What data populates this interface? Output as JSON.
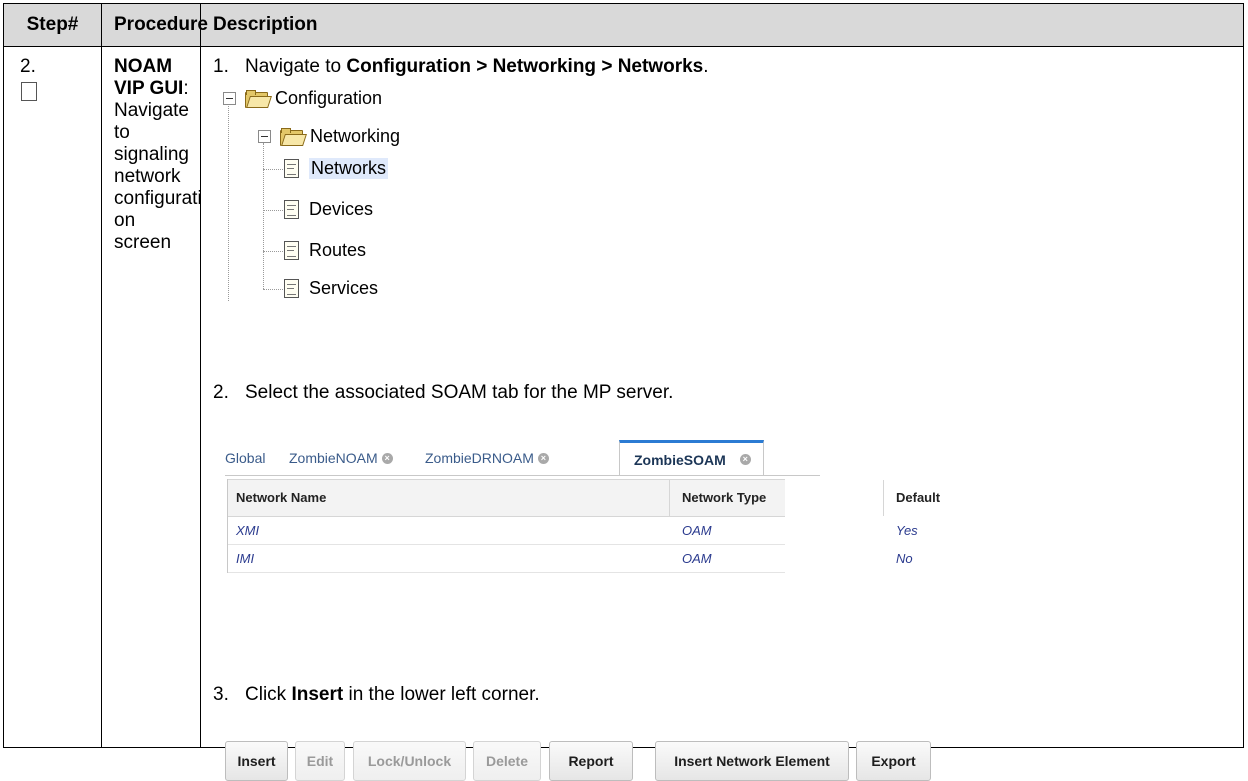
{
  "table": {
    "headers": [
      "Step#",
      "Procedure",
      "Description"
    ],
    "step": "2.",
    "procedure": {
      "bold": "NOAM VIP GUI",
      "rest_lines": [
        "Navigate to",
        "signaling",
        "network",
        "configurati",
        "on screen"
      ]
    }
  },
  "instructions": {
    "i1": {
      "num": "1.",
      "pre": "Navigate to ",
      "bold": "Configuration > Networking > Networks",
      "post": "."
    },
    "i2": {
      "num": "2.",
      "text": "Select the associated SOAM tab for the MP server."
    },
    "i3": {
      "num": "3.",
      "pre": "Click ",
      "bold": "Insert",
      "post": " in the lower left corner."
    }
  },
  "tree": {
    "root": "Configuration",
    "child": "Networking",
    "leaves": [
      "Networks",
      "Devices",
      "Routes",
      "Services"
    ],
    "selected": "Networks"
  },
  "tabs": {
    "items": [
      "Global",
      "ZombieNOAM",
      "ZombieDRNOAM",
      "ZombieSOAM"
    ],
    "active": "ZombieSOAM"
  },
  "grid": {
    "columns": [
      "Network Name",
      "Network Type",
      "Default"
    ],
    "rows": [
      [
        "XMI",
        "OAM",
        "Yes"
      ],
      [
        "IMI",
        "OAM",
        "No"
      ]
    ]
  },
  "buttons": [
    {
      "label": "Insert",
      "enabled": true
    },
    {
      "label": "Edit",
      "enabled": false
    },
    {
      "label": "Lock/Unlock",
      "enabled": false
    },
    {
      "label": "Delete",
      "enabled": false
    },
    {
      "label": "Report",
      "enabled": true
    },
    {
      "label": "Insert Network Element",
      "enabled": true
    },
    {
      "label": "Export",
      "enabled": true
    }
  ]
}
